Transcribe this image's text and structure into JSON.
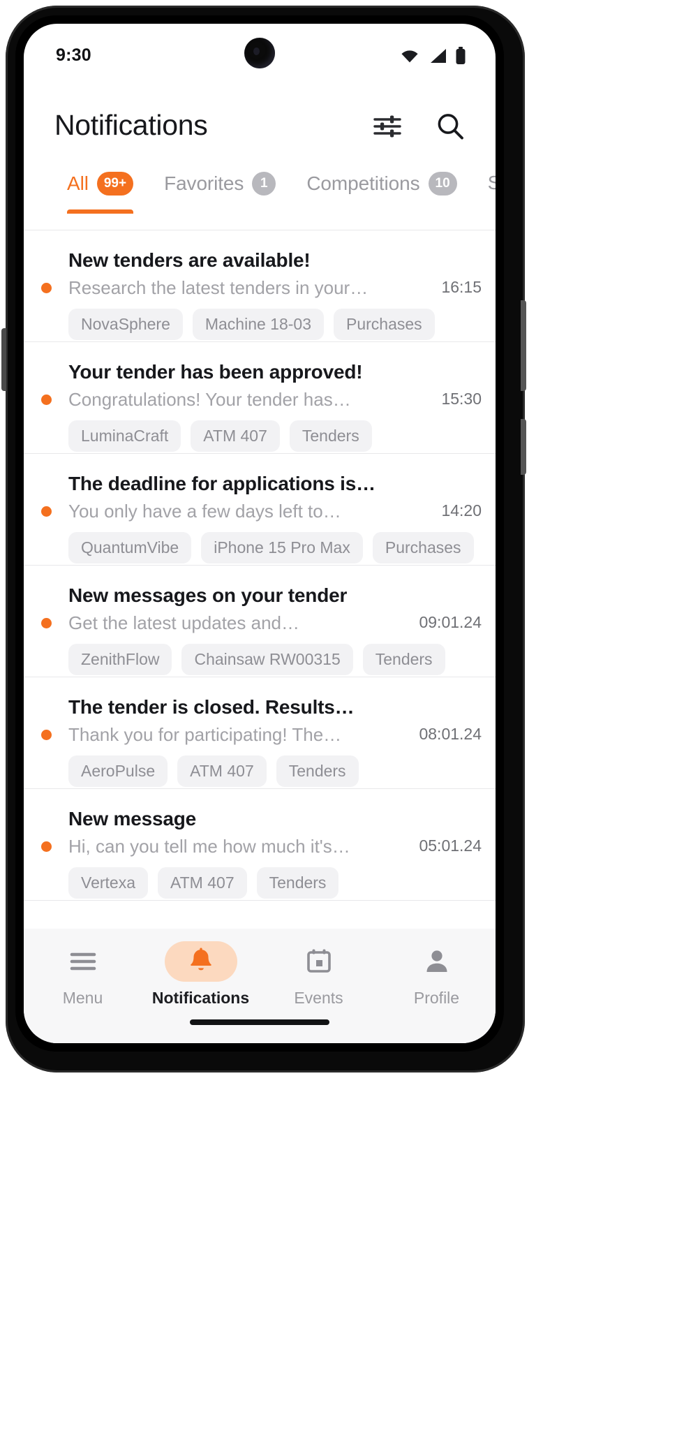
{
  "status_bar": {
    "time": "9:30",
    "icons": [
      "wifi-icon",
      "cellular-signal-icon",
      "battery-icon"
    ]
  },
  "header": {
    "title": "Notifications",
    "actions": [
      {
        "name": "filter-icon",
        "label": "Filter"
      },
      {
        "name": "search-icon",
        "label": "Search"
      }
    ]
  },
  "tabs": [
    {
      "label": "All",
      "badge": "99+",
      "active": true
    },
    {
      "label": "Favorites",
      "badge": "1",
      "active": false
    },
    {
      "label": "Competitions",
      "badge": "10",
      "active": false
    },
    {
      "label": "Subscriptions",
      "badge": "",
      "active": false
    }
  ],
  "notifications": [
    {
      "title": "New tenders are available!",
      "subtitle": "Research the latest tenders in your…",
      "time": "16:15",
      "unread": true,
      "tags": [
        "NovaSphere",
        "Machine 18-03",
        "Purchases"
      ]
    },
    {
      "title": "Your tender has been approved!",
      "subtitle": "Congratulations! Your tender has…",
      "time": "15:30",
      "unread": true,
      "tags": [
        "LuminaCraft",
        "ATM 407",
        "Tenders"
      ]
    },
    {
      "title": "The deadline for applications is…",
      "subtitle": "You only have a few days left to…",
      "time": "14:20",
      "unread": true,
      "tags": [
        "QuantumVibe",
        "iPhone 15 Pro Max",
        "Purchases"
      ]
    },
    {
      "title": "New messages on your tender",
      "subtitle": "Get the latest updates and…",
      "time": "09:01.24",
      "unread": true,
      "tags": [
        "ZenithFlow",
        "Chainsaw RW00315",
        "Tenders"
      ]
    },
    {
      "title": "The tender is closed. Results…",
      "subtitle": "Thank you for participating! The…",
      "time": "08:01.24",
      "unread": true,
      "tags": [
        "AeroPulse",
        "ATM 407",
        "Tenders"
      ]
    },
    {
      "title": "New message",
      "subtitle": "Hi, can you tell me how much it's…",
      "time": "05:01.24",
      "unread": true,
      "tags": [
        "Vertexa",
        "ATM 407",
        "Tenders"
      ]
    }
  ],
  "bottom_nav": [
    {
      "label": "Menu",
      "icon": "hamburger-menu-icon",
      "active": false
    },
    {
      "label": "Notifications",
      "icon": "bell-icon",
      "active": true
    },
    {
      "label": "Events",
      "icon": "calendar-icon",
      "active": false
    },
    {
      "label": "Profile",
      "icon": "person-icon",
      "active": false
    }
  ],
  "colors": {
    "accent": "#f4701f",
    "accent_soft": "#fcd9bf",
    "text_primary": "#17181c",
    "text_muted": "#a2a2a7",
    "tag_bg": "#f2f2f4",
    "nav_bg": "#f7f7f8"
  }
}
